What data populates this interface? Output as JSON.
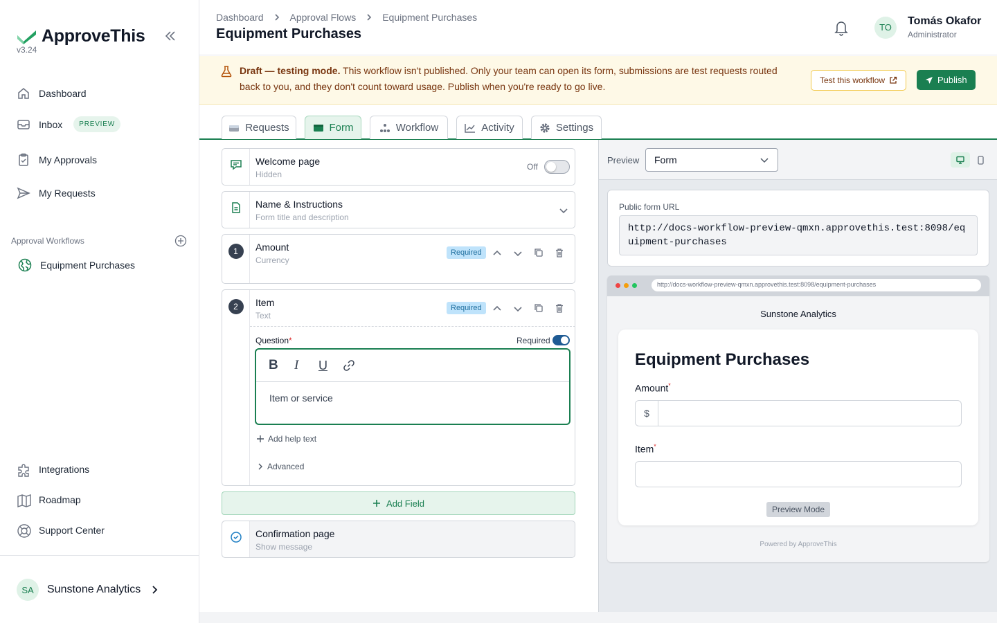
{
  "app": {
    "name": "ApproveThis",
    "version": "v3.24"
  },
  "sidebar": {
    "items": [
      {
        "label": "Dashboard",
        "icon": "home-icon"
      },
      {
        "label": "Inbox",
        "icon": "inbox-icon",
        "badge": "PREVIEW"
      },
      {
        "label": "My Approvals",
        "icon": "clipboard-check-icon"
      },
      {
        "label": "My Requests",
        "icon": "send-icon"
      }
    ],
    "workflows_label": "Approval Workflows",
    "workflows": [
      {
        "label": "Equipment Purchases",
        "icon": "globe-icon"
      }
    ],
    "bottom_items": [
      {
        "label": "Integrations",
        "icon": "puzzle-icon"
      },
      {
        "label": "Roadmap",
        "icon": "map-icon"
      },
      {
        "label": "Support Center",
        "icon": "lifebuoy-icon"
      }
    ],
    "org": {
      "initials": "SA",
      "name": "Sunstone Analytics"
    }
  },
  "header": {
    "breadcrumbs": [
      "Dashboard",
      "Approval Flows",
      "Equipment Purchases"
    ],
    "title": "Equipment Purchases",
    "user": {
      "initials": "TO",
      "name": "Tomás Okafor",
      "role": "Administrator"
    }
  },
  "banner": {
    "bold": "Draft — testing mode.",
    "text": " This workflow isn't published. Only your team can open its form, submissions are test requests routed back to you, and they don't count toward usage. Publish when you're ready to go live.",
    "test_label": "Test this workflow",
    "publish_label": "Publish"
  },
  "tabs": [
    {
      "label": "Requests",
      "active": false
    },
    {
      "label": "Form",
      "active": true
    },
    {
      "label": "Workflow",
      "active": false
    },
    {
      "label": "Activity",
      "active": false
    },
    {
      "label": "Settings",
      "active": false
    }
  ],
  "builder": {
    "welcome": {
      "title": "Welcome page",
      "sub": "Hidden",
      "toggle_label": "Off"
    },
    "name_instructions": {
      "title": "Name & Instructions",
      "sub": "Form title and description"
    },
    "fields": [
      {
        "number": "1",
        "title": "Amount",
        "sub": "Currency",
        "badge": "Required"
      },
      {
        "number": "2",
        "title": "Item",
        "sub": "Text",
        "badge": "Required"
      }
    ],
    "editor": {
      "question_label": "Question",
      "required_label": "Required",
      "content": "Item or service",
      "add_help": "Add help text",
      "advanced": "Advanced"
    },
    "add_field": "Add Field",
    "confirmation": {
      "title": "Confirmation page",
      "sub": "Show message"
    }
  },
  "preview": {
    "label": "Preview",
    "mode": "Form",
    "url_label": "Public form URL",
    "url": "http://docs-workflow-preview-qmxn.approvethis.test:8098/equipment-purchases",
    "browser_url": "http://docs-workflow-preview-qmxn.approvethis.test:8098/equipment-purchases",
    "org_name": "Sunstone Analytics",
    "form_title": "Equipment Purchases",
    "fields": [
      {
        "label": "Amount",
        "prefix": "$"
      },
      {
        "label": "Item"
      }
    ],
    "preview_mode": "Preview Mode",
    "powered": "Powered by ApproveThis"
  },
  "colors": {
    "brand": "#1a7f51",
    "banner_bg": "#fef9e7",
    "required_badge": "#bfe3fb"
  }
}
